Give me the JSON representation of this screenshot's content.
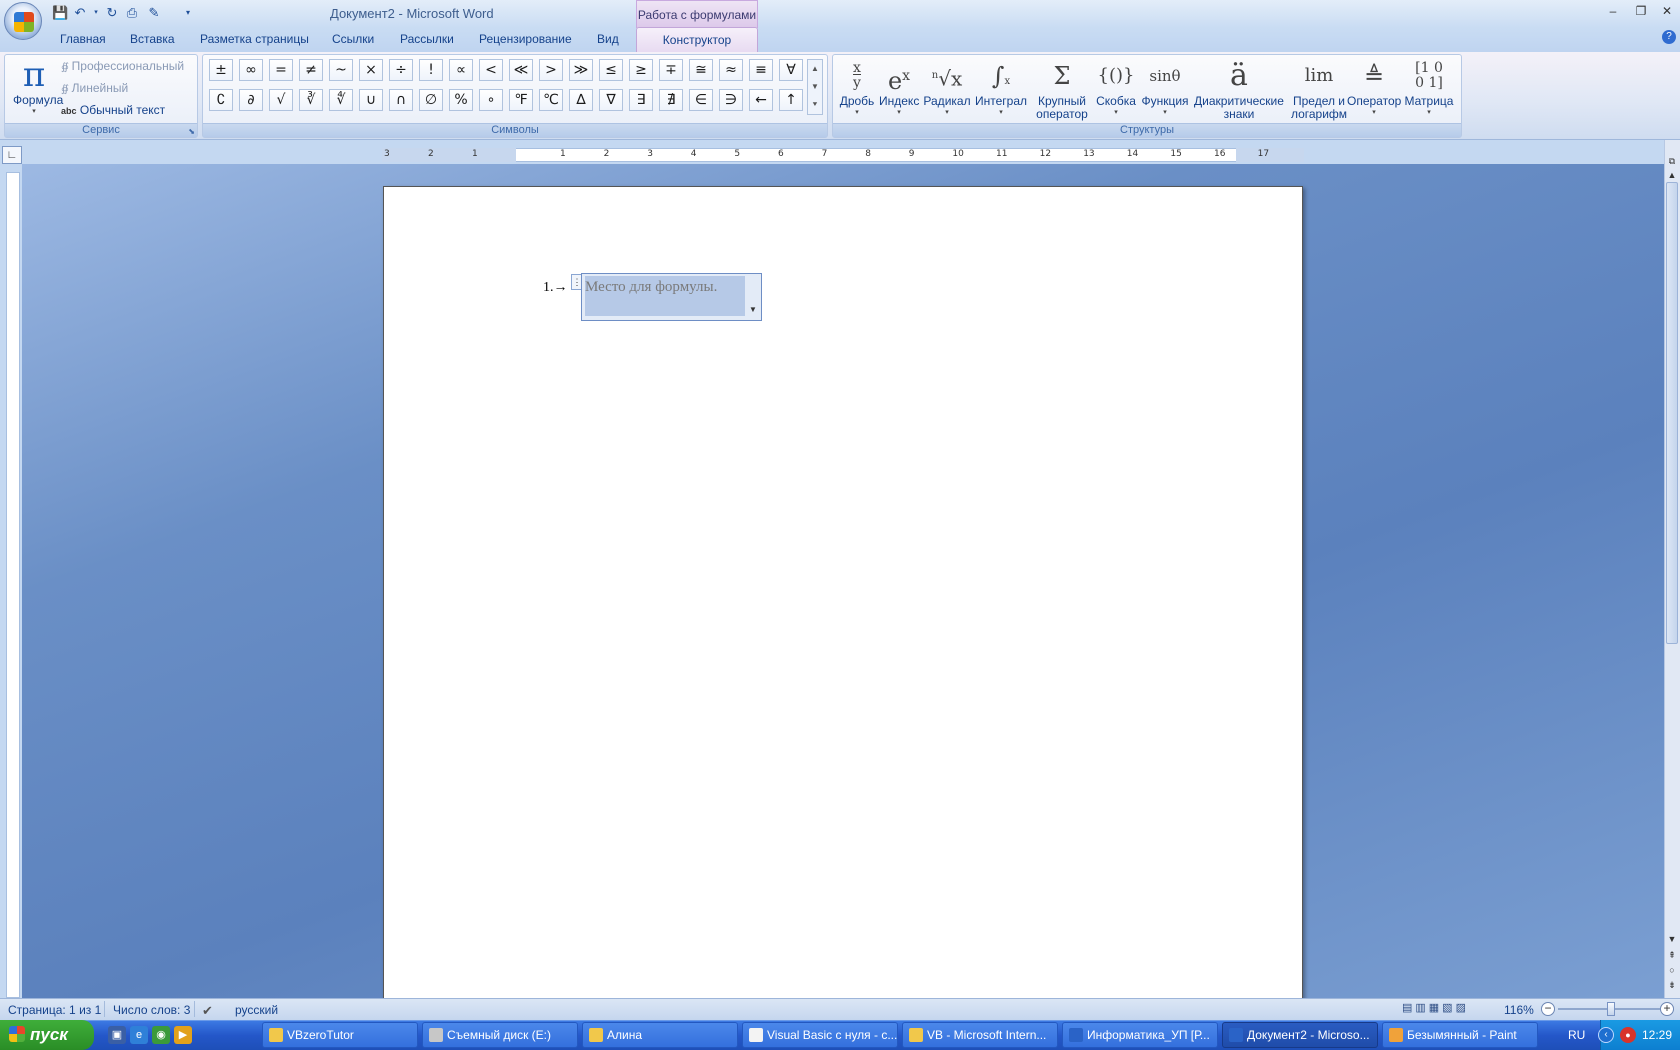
{
  "title_bar": {
    "title": "Документ2 - Microsoft Word",
    "context_tab": "Работа с формулами",
    "minimize": "‒",
    "maximize": "❐",
    "close": "✕"
  },
  "tabs": [
    "Главная",
    "Вставка",
    "Разметка страницы",
    "Ссылки",
    "Рассылки",
    "Рецензирование",
    "Вид"
  ],
  "active_tab": "Конструктор",
  "ribbon": {
    "service": {
      "formula_label": "Формула",
      "professional": "Профессиональный",
      "linear": "Линейный",
      "abc": "abc",
      "plain_text": "Обычный текст",
      "group_label": "Сервис"
    },
    "symbols": {
      "row1": [
        "±",
        "∞",
        "=",
        "≠",
        "~",
        "×",
        "÷",
        "!",
        "∝",
        "<",
        "≪",
        ">",
        "≫",
        "≤",
        "≥",
        "∓",
        "≅",
        "≈",
        "≡",
        "∀"
      ],
      "row2": [
        "∁",
        "∂",
        "√",
        "∛",
        "∜",
        "∪",
        "∩",
        "∅",
        "%",
        "∘",
        "℉",
        "℃",
        "∆",
        "∇",
        "∃",
        "∄",
        "∈",
        "∋",
        "←",
        "↑"
      ],
      "group_label": "Символы"
    },
    "structures": {
      "items": [
        {
          "label": "Дробь",
          "icon": "x/y"
        },
        {
          "label": "Индекс",
          "icon": "eˣ"
        },
        {
          "label": "Радикал",
          "icon": "ⁿ√x"
        },
        {
          "label": "Интеграл",
          "icon": "∫"
        },
        {
          "label": "Крупный оператор",
          "icon": "Σ"
        },
        {
          "label": "Скобка",
          "icon": "{()}"
        },
        {
          "label": "Функция",
          "icon": "sinθ"
        },
        {
          "label": "Диакритические знаки",
          "icon": "ä"
        },
        {
          "label": "Предел и логарифм",
          "icon": "lim"
        },
        {
          "label": "Оператор",
          "icon": "≜"
        },
        {
          "label": "Матрица",
          "icon": "[10;01]"
        }
      ],
      "group_label": "Структуры"
    }
  },
  "ruler": {
    "labels": [
      "3",
      "2",
      "1",
      "1",
      "2",
      "3",
      "4",
      "5",
      "6",
      "7",
      "8",
      "9",
      "10",
      "11",
      "12",
      "13",
      "14",
      "15",
      "16",
      "17"
    ]
  },
  "document": {
    "list_number": "1.→",
    "equation_placeholder": "Место для формулы."
  },
  "status_bar": {
    "page": "Страница: 1 из 1",
    "words": "Число слов: 3",
    "language": "русский",
    "zoom": "116%",
    "zoom_level_percent": 116
  },
  "taskbar": {
    "start_label": "пуск",
    "buttons": [
      {
        "label": "VBzeroTutor",
        "icon": "folder-icon",
        "active": false
      },
      {
        "label": "Съемный диск (E:)",
        "icon": "drive-icon",
        "active": false
      },
      {
        "label": "Алина",
        "icon": "folder-icon",
        "active": false
      },
      {
        "label": "Visual Basic с нуля - с...",
        "icon": "document-icon",
        "active": false
      },
      {
        "label": "VB - Microsoft Intern...",
        "icon": "folder-icon",
        "active": false
      },
      {
        "label": "Информатика_УП [Р...",
        "icon": "word-icon",
        "active": false
      },
      {
        "label": "Документ2 - Microso...",
        "icon": "word-icon",
        "active": true
      },
      {
        "label": "Безымянный - Paint",
        "icon": "paint-icon",
        "active": false
      }
    ],
    "language": "RU",
    "time": "12:29"
  },
  "colors": {
    "accent": "#15428b",
    "taskbar": "#2457c9",
    "start": "#3fae3a"
  }
}
